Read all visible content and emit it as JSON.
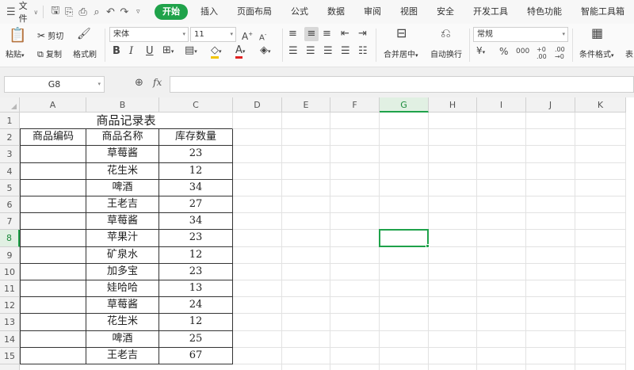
{
  "menubar": {
    "file_label": "文件",
    "tabs": [
      "开始",
      "插入",
      "页面布局",
      "公式",
      "数据",
      "审阅",
      "视图",
      "安全",
      "开发工具",
      "特色功能",
      "智能工具箱"
    ],
    "active_tab": "开始"
  },
  "ribbon": {
    "paste": "粘贴",
    "cut": "剪切",
    "copy": "复制",
    "format_painter": "格式刷",
    "font_name": "宋体",
    "font_size": "11",
    "merge_center": "合并居中",
    "wrap_text": "自动换行",
    "number_format": "常规",
    "conditional_format": "条件格式",
    "table_style": "表"
  },
  "formula_bar": {
    "name_box": "G8",
    "fx": "fx",
    "formula": ""
  },
  "sheet": {
    "columns": [
      "A",
      "B",
      "C",
      "D",
      "E",
      "F",
      "G",
      "H",
      "I",
      "J",
      "K"
    ],
    "selected_column": "G",
    "rows": [
      "1",
      "2",
      "3",
      "4",
      "5",
      "6",
      "7",
      "8",
      "9",
      "10",
      "11",
      "12",
      "13",
      "14",
      "15"
    ],
    "selected_row": "8",
    "title": "商品记录表",
    "headers": [
      "商品编码",
      "商品名称",
      "库存数量"
    ],
    "records": [
      {
        "code": "",
        "name": "草莓酱",
        "qty": "23"
      },
      {
        "code": "",
        "name": "花生米",
        "qty": "12"
      },
      {
        "code": "",
        "name": "啤酒",
        "qty": "34"
      },
      {
        "code": "",
        "name": "王老吉",
        "qty": "27"
      },
      {
        "code": "",
        "name": "草莓酱",
        "qty": "34"
      },
      {
        "code": "",
        "name": "苹果汁",
        "qty": "23"
      },
      {
        "code": "",
        "name": "矿泉水",
        "qty": "12"
      },
      {
        "code": "",
        "name": "加多宝",
        "qty": "23"
      },
      {
        "code": "",
        "name": "娃哈哈",
        "qty": "13"
      },
      {
        "code": "",
        "name": "草莓酱",
        "qty": "24"
      },
      {
        "code": "",
        "name": "花生米",
        "qty": "12"
      },
      {
        "code": "",
        "name": "啤酒",
        "qty": "25"
      },
      {
        "code": "",
        "name": "王老吉",
        "qty": "67"
      }
    ]
  },
  "colors": {
    "accent": "#1fa24a"
  }
}
